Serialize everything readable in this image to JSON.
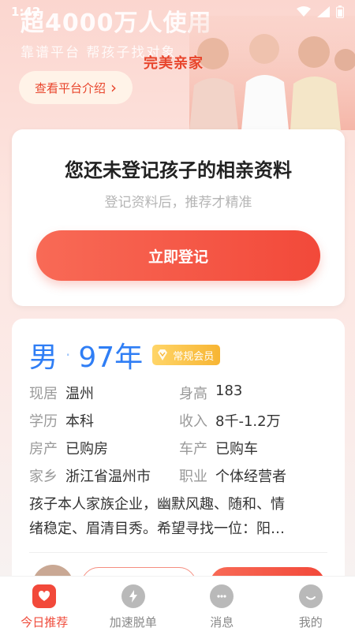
{
  "status_bar": {
    "time": "1:42"
  },
  "hero": {
    "title": "超4000万人使用",
    "subtitle": "靠谱平台 帮孩子找对象",
    "brand": "完美亲家",
    "intro_button": "查看平台介绍",
    "intro_arrow": "›"
  },
  "register_card": {
    "title": "您还未登记孩子的相亲资料",
    "subtitle": "登记资料后，推荐才精准",
    "button": "立即登记"
  },
  "profile": {
    "gender": "男",
    "separator": "·",
    "birth_year": "97年",
    "badge": "常规会员",
    "rows": [
      [
        {
          "label": "现居",
          "value": "温州"
        },
        {
          "label": "身高",
          "value": "183"
        }
      ],
      [
        {
          "label": "学历",
          "value": "本科"
        },
        {
          "label": "收入",
          "value": "8千-1.2万"
        }
      ],
      [
        {
          "label": "房产",
          "value": "已购房"
        },
        {
          "label": "车产",
          "value": "已购车"
        }
      ],
      [
        {
          "label": "家乡",
          "value": "浙江省温州市"
        },
        {
          "label": "职业",
          "value": "个体经营者"
        }
      ]
    ],
    "description_line1": "孩子本人家族企业，幽默风趣、随和、情",
    "description_line2": "绪稳定、眉清目秀。希望寻找一位：阳…"
  },
  "tab_bar": {
    "tabs": [
      {
        "label": "今日推荐",
        "icon": "home-heart-icon",
        "active": true
      },
      {
        "label": "加速脱单",
        "icon": "lightning-icon",
        "active": false
      },
      {
        "label": "消息",
        "icon": "chat-bubble-icon",
        "active": false
      },
      {
        "label": "我的",
        "icon": "profile-face-icon",
        "active": false
      }
    ]
  },
  "colors": {
    "accent": "#f2493a",
    "blue": "#2f7ef5",
    "gold": "#f7b533"
  }
}
